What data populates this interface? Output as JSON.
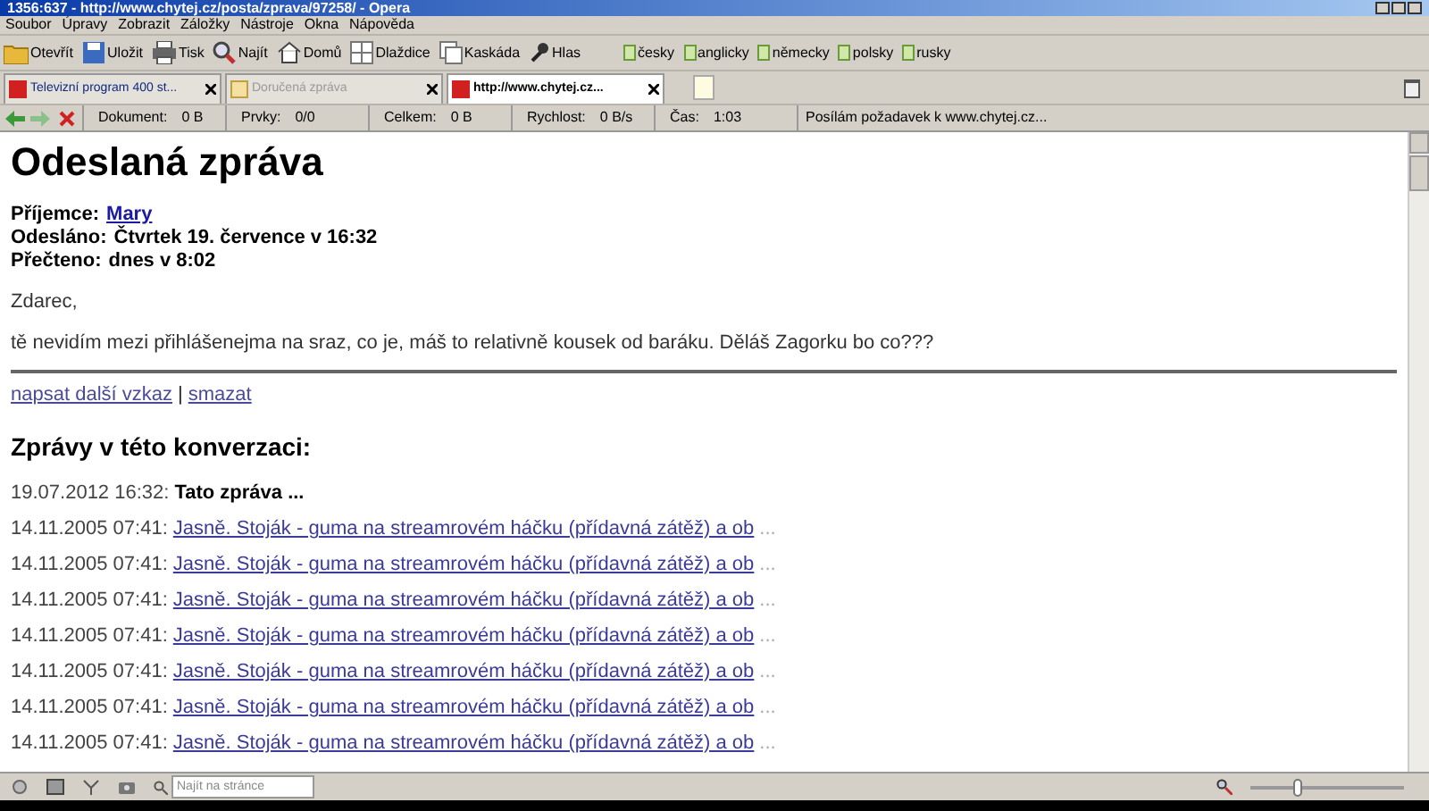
{
  "window": {
    "title": "1356:637 - http://www.chytej.cz/posta/zprava/97258/ - Opera"
  },
  "menu": [
    "Soubor",
    "Úpravy",
    "Zobrazit",
    "Záložky",
    "Nástroje",
    "Okna",
    "Nápověda"
  ],
  "toolbar": [
    {
      "label": "Otevřít",
      "kind": "folder"
    },
    {
      "label": "Uložit",
      "kind": "save"
    },
    {
      "label": "Tisk",
      "kind": "print"
    },
    {
      "label": "Najít",
      "kind": "find"
    },
    {
      "label": "Domů",
      "kind": "home"
    },
    {
      "label": "Dlaždice",
      "kind": "tile"
    },
    {
      "label": "Kaskáda",
      "kind": "cascade"
    },
    {
      "label": "Hlas",
      "kind": "voice"
    }
  ],
  "languages": [
    "česky",
    "anglicky",
    "německy",
    "polsky",
    "rusky"
  ],
  "tabs": [
    {
      "label": "Televizní program 400 st...",
      "selected": false,
      "loaded": true
    },
    {
      "label": "Doručená zpráva",
      "selected": false,
      "loaded": false
    },
    {
      "label": "http://www.chytej.cz...",
      "selected": true,
      "loaded": true
    }
  ],
  "progress": [
    {
      "label": "Dokument:",
      "value": "0 B"
    },
    {
      "label": "Prvky:",
      "value": "0/0"
    },
    {
      "label": "Celkem:",
      "value": "0 B"
    },
    {
      "label": "Rychlost:",
      "value": "0 B/s"
    },
    {
      "label": "Čas:",
      "value": "1:03"
    }
  ],
  "status_message": "Posílám požadavek k www.chytej.cz...",
  "page": {
    "heading": "Odeslaná zpráva",
    "meta": [
      {
        "label": "Příjemce:",
        "value": "Mary",
        "link": true
      },
      {
        "label": "Odesláno:",
        "value": "Čtvrtek 19. července v 16:32",
        "link": false
      },
      {
        "label": "Přečteno:",
        "value": "dnes v 8:02",
        "link": false
      }
    ],
    "body": [
      "Zdarec,",
      "tě nevidím mezi přihlášenejma na sraz, co je, máš to relativně kousek od baráku. Děláš Zagorku bo co???"
    ],
    "actions": [
      "napsat další vzkaz",
      "smazat"
    ],
    "actions_separator": "|",
    "conversation_heading": "Zprávy v této konverzaci:",
    "conversation": [
      {
        "date": "19.07.2012 16:32:",
        "subject": "Tato zpráva ...",
        "current": true
      },
      {
        "date": "14.11.2005 07:41:",
        "subject": "Jasně. Stoják - guma na streamrovém háčku (přídavná zátěž) a ob",
        "current": false
      },
      {
        "date": "14.11.2005 07:41:",
        "subject": "Jasně. Stoják - guma na streamrovém háčku (přídavná zátěž) a ob",
        "current": false
      },
      {
        "date": "14.11.2005 07:41:",
        "subject": "Jasně. Stoják - guma na streamrovém háčku (přídavná zátěž) a ob",
        "current": false
      },
      {
        "date": "14.11.2005 07:41:",
        "subject": "Jasně. Stoják - guma na streamrovém háčku (přídavná zátěž) a ob",
        "current": false
      },
      {
        "date": "14.11.2005 07:41:",
        "subject": "Jasně. Stoják - guma na streamrovém háčku (přídavná zátěž) a ob",
        "current": false
      },
      {
        "date": "14.11.2005 07:41:",
        "subject": "Jasně. Stoják - guma na streamrovém háčku (přídavná zátěž) a ob",
        "current": false
      },
      {
        "date": "14.11.2005 07:41:",
        "subject": "Jasně. Stoják - guma na streamrovém háčku (přídavná zátěž) a ob",
        "current": false
      }
    ],
    "ellipsis": "..."
  },
  "bottom_bar": {
    "search": {
      "placeholder": "Najít na stránce"
    },
    "zoom": {
      "level": 0.3
    }
  }
}
